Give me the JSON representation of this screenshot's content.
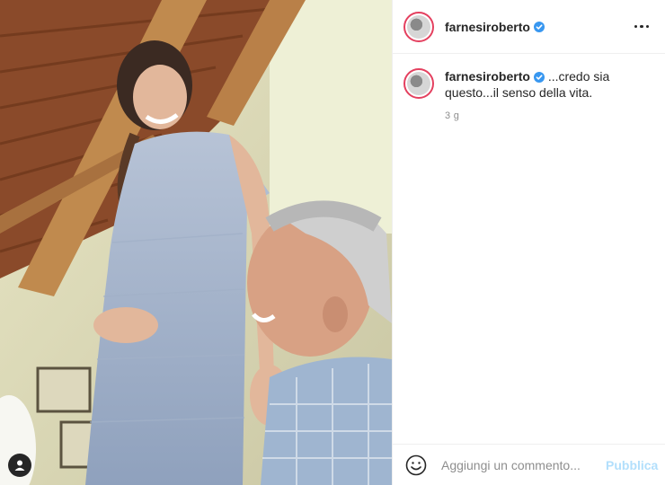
{
  "post": {
    "username": "farnesiroberto",
    "caption": "...credo sia questo...il senso della vita.",
    "timestamp": "3 g"
  },
  "composer": {
    "placeholder": "Aggiungi un commento...",
    "publish_label": "Pubblica"
  },
  "colors": {
    "verified": "#3897f0",
    "publish_disabled": "#b2dffc",
    "story_ring": "#e4405f"
  }
}
